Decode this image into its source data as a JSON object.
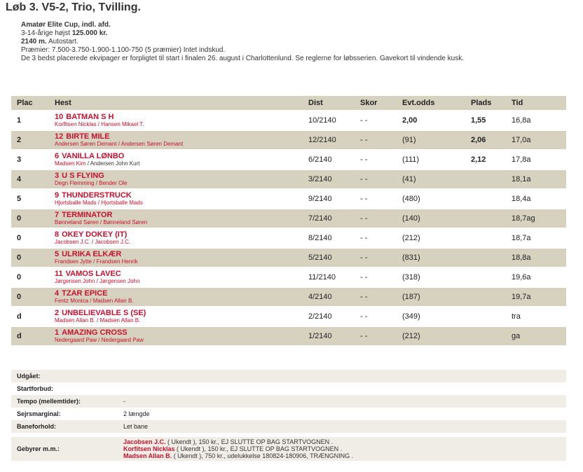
{
  "race": {
    "title": "Løb 3. V5-2, Trio, Tvilling.",
    "name": "Amatør Elite Cup, indl. afd.",
    "cond_prefix": "3-14-årige højst",
    "cond_amount": "125.000 kr.",
    "distance": "2140 m.",
    "start_type": "Autostart.",
    "prizes": "Præmier: 7.500-3.750-1.900-1.100-750 (5 præmier) Intet indskud.",
    "note": "De 3 bedst placerede ekvipager er forpligtet til start i finalen 26. august i Charlottenlund. Se reglerne for løbsserien. Gavekort til vindende kusk."
  },
  "table": {
    "headers": {
      "plac": "Plac",
      "hest": "Hest",
      "dist": "Dist",
      "skor": "Skor",
      "evt": "Evt.odds",
      "plads": "Plads",
      "tid": "Tid"
    },
    "rows": [
      {
        "plac": "1",
        "num": "10",
        "name": "BATMAN S H",
        "driver": "Korfitsen Nicklas",
        "trainer": "Hansen Mikael T.",
        "dist": "10/2140",
        "skor": "- -",
        "evt": "2,00",
        "plads": "1,55",
        "tid": "16,8a"
      },
      {
        "plac": "2",
        "num": "12",
        "name": "BIRTE MILE",
        "driver": "Andersen Søren Demant",
        "trainer": "Andersen Søren Demant",
        "dist": "12/2140",
        "skor": "- -",
        "evt": "(91)",
        "plads": "2,06",
        "tid": "17,0a"
      },
      {
        "plac": "3",
        "num": "6",
        "name": "VANILLA LØNBO",
        "driver": "Madsen Kim",
        "trainer": "Andersen John Kurt",
        "dist": "6/2140",
        "skor": "- -",
        "evt": "(111)",
        "plads": "2,12",
        "tid": "17,8a"
      },
      {
        "plac": "4",
        "num": "3",
        "name": "U S FLYING",
        "driver": "Degn Flemming",
        "trainer": "Bender Ole",
        "dist": "3/2140",
        "skor": "- -",
        "evt": "(41)",
        "plads": "",
        "tid": "18,1a"
      },
      {
        "plac": "5",
        "num": "9",
        "name": "THUNDERSTRUCK",
        "driver": "Hjortsballe Mads",
        "trainer": "Hjortsballe Mads",
        "dist": "9/2140",
        "skor": "- -",
        "evt": "(480)",
        "plads": "",
        "tid": "18,4a"
      },
      {
        "plac": "0",
        "num": "7",
        "name": "TERMINATOR",
        "driver": "Bønneland Søren",
        "trainer": "Bønneland Søren",
        "dist": "7/2140",
        "skor": "- -",
        "evt": "(140)",
        "plads": "",
        "tid": "18,7ag"
      },
      {
        "plac": "0",
        "num": "8",
        "name": "OKEY DOKEY (IT)",
        "driver": "Jacobsen J.C.",
        "trainer": "Jacobsen J.C.",
        "dist": "8/2140",
        "skor": "- -",
        "evt": "(212)",
        "plads": "",
        "tid": "18,7a"
      },
      {
        "plac": "0",
        "num": "5",
        "name": "ULRIKA ELKÆR",
        "driver": "Frandsen Jytte",
        "trainer": "Frandsen Henrik",
        "dist": "5/2140",
        "skor": "- -",
        "evt": "(831)",
        "plads": "",
        "tid": "18,8a"
      },
      {
        "plac": "0",
        "num": "11",
        "name": "VAMOS LAVEC",
        "driver": "Jørgensen John",
        "trainer": "Jørgensen John",
        "dist": "11/2140",
        "skor": "- -",
        "evt": "(318)",
        "plads": "",
        "tid": "19,6a"
      },
      {
        "plac": "0",
        "num": "4",
        "name": "TZAR EPICE",
        "driver": "Fentz Monica",
        "trainer": "Madsen Allan B.",
        "dist": "4/2140",
        "skor": "- -",
        "evt": "(187)",
        "plads": "",
        "tid": "19,7a"
      },
      {
        "plac": "d",
        "num": "2",
        "name": "UNBELIEVABLE S (SE)",
        "driver": "Madsen Allan B.",
        "trainer": "Madsen Allan B.",
        "dist": "2/2140",
        "skor": "- -",
        "evt": "(349)",
        "plads": "",
        "tid": "tra"
      },
      {
        "plac": "d",
        "num": "1",
        "name": "AMAZING CROSS",
        "driver": "Nedergaard Paw",
        "trainer": "Nedergaard Paw",
        "dist": "1/2140",
        "skor": "- -",
        "evt": "(212)",
        "plads": "",
        "tid": "ga"
      }
    ]
  },
  "extra": {
    "udgaaet_label": "Udgået:",
    "startforbud_label": "Startforbud:",
    "tempo_label": "Tempo (mellemtider):",
    "tempo_value": "-",
    "sejrsmargin_label": "Sejrsmarginal:",
    "sejrsmargin_value": "2 længde",
    "baneforhold_label": "Baneforhold:",
    "baneforhold_value": "Let bane",
    "gebyrer_label": "Gebyrer m.m.:",
    "fees": [
      {
        "name": "Jacobsen J.C.",
        "text": " ( Ukendt ), 150 kr., EJ SLUTTE OP BAG STARTVOGNEN ."
      },
      {
        "name": "Korfitsen Nicklas",
        "text": " ( Ukendt ), 150 kr., EJ SLUTTE OP BAG STARTVOGNEN ."
      },
      {
        "name": "Madsen Allan B.",
        "text": " ( Ukendt ), 750 kr., udelukkelse 180824-180906, TRÆNGNING ."
      }
    ]
  }
}
